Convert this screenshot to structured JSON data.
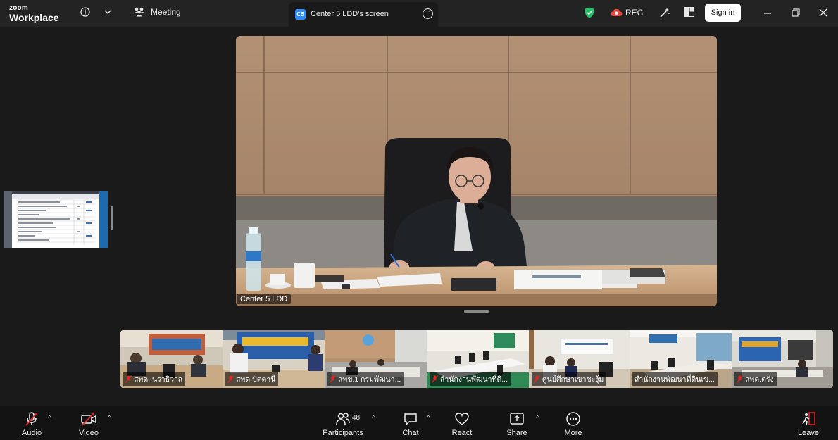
{
  "app": {
    "brand_small": "zoom",
    "brand_big": "Workplace"
  },
  "topbar": {
    "meeting_label": "Meeting",
    "tab_title": "Center 5 LDD's screen",
    "tab_badge": "C5",
    "rec_label": "REC",
    "sign_in_label": "Sign in"
  },
  "main_video": {
    "participant_label": "Center 5 LDD"
  },
  "strip": {
    "tiles": [
      {
        "name": "สพด. นราธิวาส"
      },
      {
        "name": "สพด.ปัตตานี"
      },
      {
        "name": "สพข.1 กรมพัฒนา..."
      },
      {
        "name": "สำนักงานพัฒนาที่ดิ..."
      },
      {
        "name": "ศูนย์ศึกษาเขาชะงุ้ม"
      },
      {
        "name": "สำนักงานพัฒนาที่ดินเข..."
      },
      {
        "name": "สพด.ตรัง"
      }
    ]
  },
  "toolbar": {
    "audio_label": "Audio",
    "video_label": "Video",
    "participants_label": "Participants",
    "participants_count": "48",
    "chat_label": "Chat",
    "react_label": "React",
    "share_label": "Share",
    "more_label": "More",
    "leave_label": "Leave"
  },
  "colors": {
    "accent": "#2d8cff",
    "mute_red": "#e02828",
    "shield_green": "#27c267",
    "cloud_red": "#e8453c"
  }
}
